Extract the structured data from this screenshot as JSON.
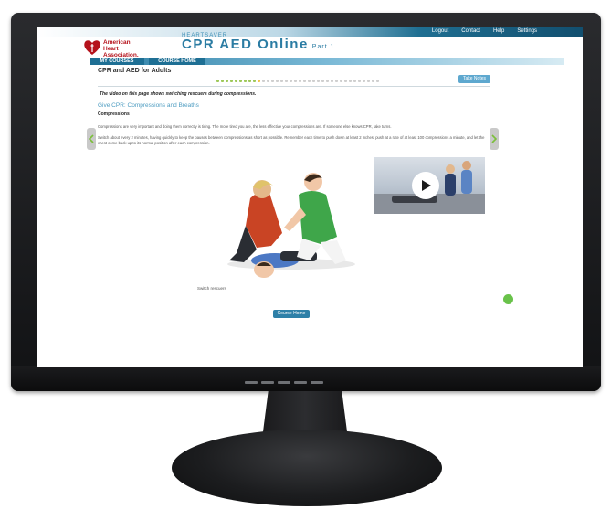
{
  "topnav": {
    "links": [
      "Logout",
      "Contact",
      "Help",
      "Settings"
    ]
  },
  "logo": {
    "line1": "American",
    "line2": "Heart",
    "line3": "Association."
  },
  "course": {
    "subtitle": "HEARTSAVER",
    "title": "CPR AED Online",
    "part": "Part 1"
  },
  "tabs": {
    "my_courses": "MY COURSES",
    "course_home": "COURSE HOME"
  },
  "lesson": {
    "title": "CPR and AED for Adults",
    "take_notes": "Take Notes",
    "video_note": "The video on this page shows switching rescuers during compressions.",
    "section_heading": "Give CPR: Compressions and Breaths",
    "subheading": "Compressions",
    "paragraph1": "Compressions are very important and doing them correctly is tiring. The more tired you are, the less effective your compressions are. If someone else knows CPR, take turns.",
    "paragraph2": "Switch about every 2 minutes, having quickly to keep the pauses between compressions as short as possible. Remember each time to push down at least 2 inches, push at a rate of at least 100 compressions a minute, and let the chest come back up to its normal position after each compression.",
    "caption": "Switch rescuers",
    "course_home_button": "Course Home"
  },
  "progress": {
    "completed": 9,
    "current": 1,
    "total": 36
  },
  "colors": {
    "brand_red": "#b5121b",
    "brand_blue": "#2b7ca3",
    "status_green": "#69c24a"
  },
  "icons": {
    "prev": "chevron-left-icon",
    "next": "chevron-right-icon",
    "video": "play-icon",
    "logo": "heart-torch-logo"
  }
}
